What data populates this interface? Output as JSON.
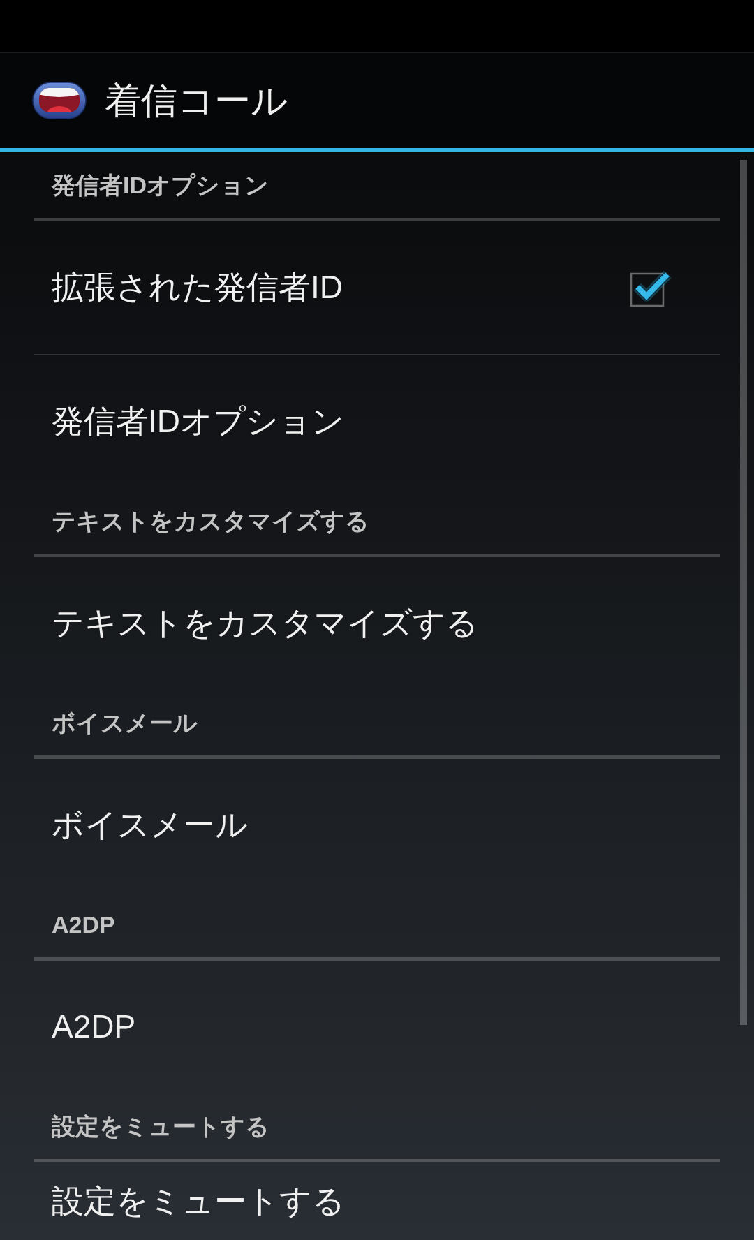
{
  "action_bar": {
    "title": "着信コール"
  },
  "sections": [
    {
      "title": "発信者IDオプション",
      "items": [
        {
          "kind": "checkbox",
          "title": "拡張された発信者ID",
          "checked": true
        },
        {
          "kind": "text",
          "title": "発信者IDオプション"
        }
      ]
    },
    {
      "title": "テキストをカスタマイズする",
      "items": [
        {
          "kind": "text",
          "title": "テキストをカスタマイズする"
        }
      ]
    },
    {
      "title": "ボイスメール",
      "items": [
        {
          "kind": "text",
          "title": "ボイスメール"
        }
      ]
    },
    {
      "title": "A2DP",
      "items": [
        {
          "kind": "text",
          "title": "A2DP"
        }
      ]
    },
    {
      "title": "設定をミュートする",
      "items": [
        {
          "kind": "text",
          "title": "設定をミュートする"
        }
      ]
    }
  ]
}
